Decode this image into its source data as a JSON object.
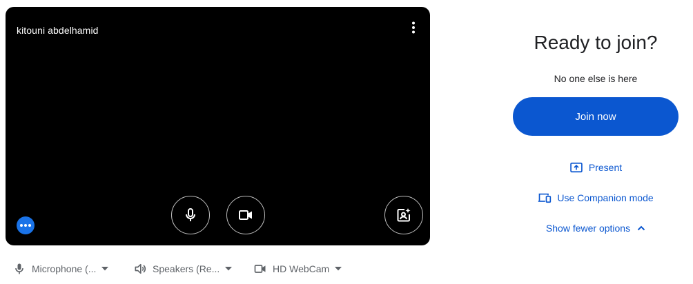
{
  "preview": {
    "participant_name": "kitouni abdelhamid"
  },
  "controls": {
    "mic_icon": "microphone-icon",
    "camera_icon": "videocam-icon",
    "effects_icon": "visual-effects-icon",
    "more_icon": "more-vert-icon"
  },
  "devices": {
    "microphone": "Microphone (...",
    "speakers": "Speakers (Re...",
    "camera": "HD WebCam"
  },
  "panel": {
    "title": "Ready to join?",
    "status": "No one else is here",
    "join_label": "Join now",
    "present_label": "Present",
    "companion_label": "Use Companion mode",
    "fewer_options_label": "Show fewer options"
  },
  "colors": {
    "accent": "#0b57d0",
    "preview_bg": "#000000",
    "dots_button": "#1a73e8"
  }
}
